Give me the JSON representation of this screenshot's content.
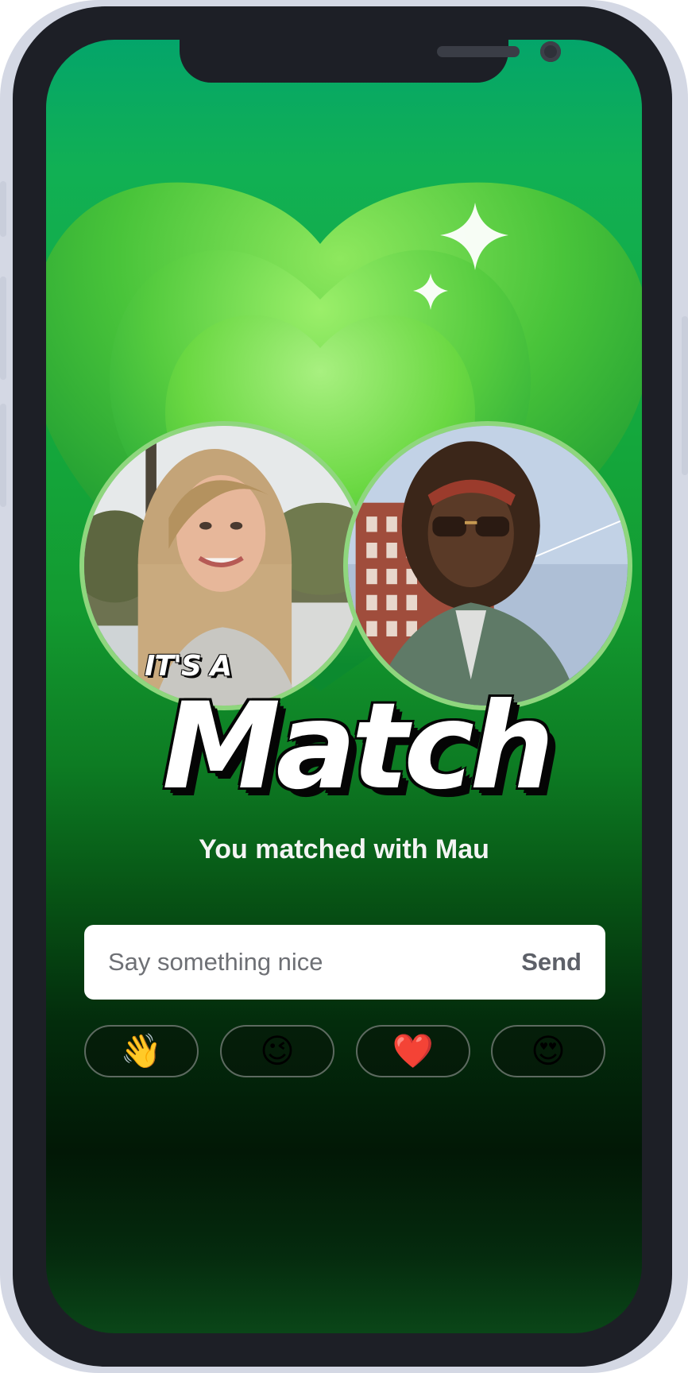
{
  "app": {
    "title_small": "IT'S A",
    "title_large": "Match",
    "subtitle": "You matched with Mau"
  },
  "photos": {
    "user_alt": "Your profile photo",
    "match_alt": "Mau's profile photo"
  },
  "message": {
    "placeholder": "Say something nice",
    "value": "",
    "send_label": "Send"
  },
  "quick_replies": [
    {
      "emoji": "👋",
      "icon": "waving-hand-icon"
    },
    {
      "emoji": "😉",
      "icon": "winking-face-icon"
    },
    {
      "emoji": "❤️",
      "icon": "red-heart-icon"
    },
    {
      "emoji": "😍",
      "icon": "heart-eyes-icon"
    }
  ],
  "colors": {
    "accent_green": "#14a83d",
    "deep_green": "#021806",
    "heart_light": "#a8f080",
    "send_gray": "#5d6068"
  }
}
